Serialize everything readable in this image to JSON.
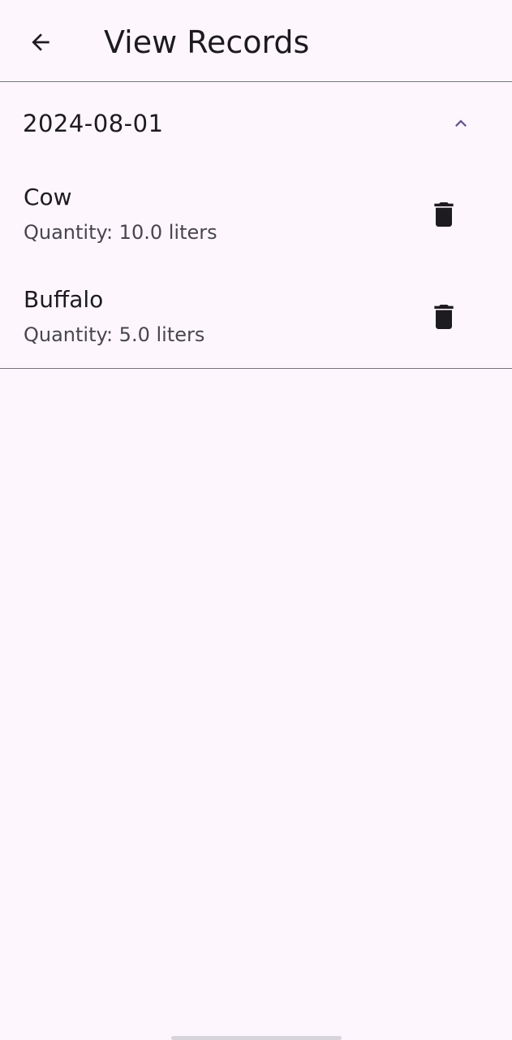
{
  "app_bar": {
    "title": "View Records",
    "back_icon": "arrow-back-icon"
  },
  "groups": [
    {
      "date": "2024-08-01",
      "expanded": true,
      "toggle_icon": "chevron-up-icon",
      "records": [
        {
          "name": "Cow",
          "quantity": "Quantity: 10.0 liters",
          "delete_icon": "trash-icon"
        },
        {
          "name": "Buffalo",
          "quantity": "Quantity: 5.0 liters",
          "delete_icon": "trash-icon"
        }
      ]
    }
  ],
  "colors": {
    "background": "#fdf7fd",
    "text_primary": "#1d1b20",
    "text_secondary": "#49454f",
    "accent": "#65558f",
    "divider": "#79747e",
    "icon": "#1d1b20"
  }
}
